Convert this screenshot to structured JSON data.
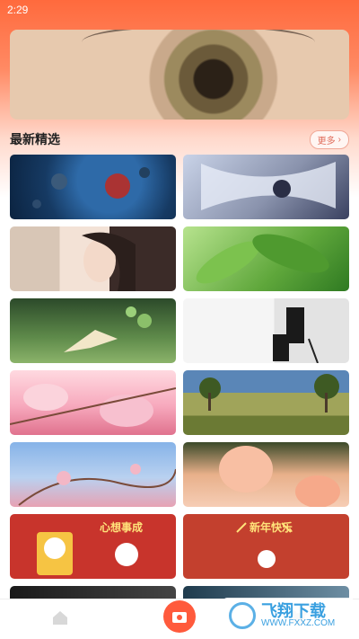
{
  "status": {
    "time": "2:29"
  },
  "section": {
    "title": "最新精选",
    "more_label": "更多",
    "more_chevron": "›"
  },
  "tiles": [
    {
      "name": "tile-asteroids"
    },
    {
      "name": "tile-anime-girl"
    },
    {
      "name": "tile-woman-portrait"
    },
    {
      "name": "tile-green-leaves"
    },
    {
      "name": "tile-bird-plant"
    },
    {
      "name": "tile-man-chair"
    },
    {
      "name": "tile-magnolia"
    },
    {
      "name": "tile-landscape-trees"
    },
    {
      "name": "tile-cherry-blossom"
    },
    {
      "name": "tile-tulips"
    },
    {
      "name": "tile-rabbit-red-1",
      "text": "心想事成"
    },
    {
      "name": "tile-rabbit-red-2",
      "text": "新年快乐"
    },
    {
      "name": "tile-dark-portrait"
    },
    {
      "name": "tile-blue-scene"
    }
  ],
  "watermark": {
    "title": "飞翔下载",
    "url": "WWW.FXXZ.COM"
  },
  "colors": {
    "accent": "#ff5a3c",
    "tag_border": "#f0a999"
  },
  "icons": {
    "home": "home-icon",
    "center": "wallpaper-icon",
    "profile": "bear-icon"
  }
}
